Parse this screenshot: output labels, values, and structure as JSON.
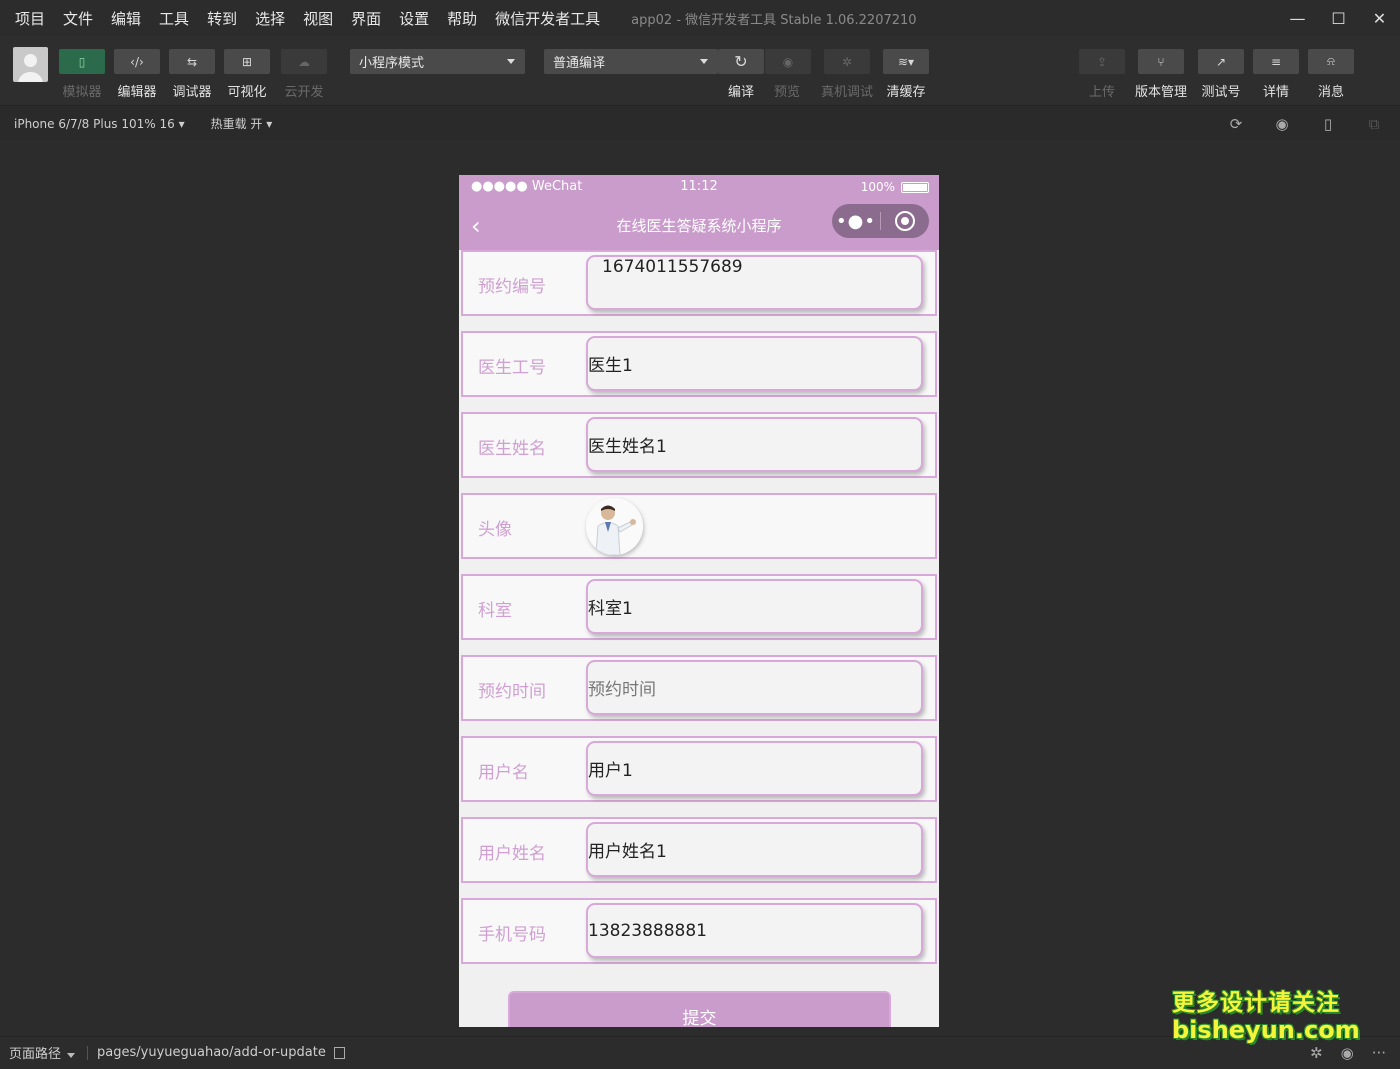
{
  "menubar": {
    "items": [
      "项目",
      "文件",
      "编辑",
      "工具",
      "转到",
      "选择",
      "视图",
      "界面",
      "设置",
      "帮助",
      "微信开发者工具"
    ],
    "window_title": "app02 - 微信开发者工具 Stable 1.06.2207210"
  },
  "toolbar": {
    "modes": [
      {
        "label": "模拟器",
        "icon": "phone-icon"
      },
      {
        "label": "编辑器",
        "icon": "code-icon"
      },
      {
        "label": "调试器",
        "icon": "debug-icon"
      },
      {
        "label": "可视化",
        "icon": "layout-icon"
      },
      {
        "label": "云开发",
        "icon": "cloud-icon"
      }
    ],
    "mode_select": "小程序模式",
    "compile_select": "普通编译",
    "actions": [
      {
        "label": "编译",
        "icon": "refresh-icon"
      },
      {
        "label": "预览",
        "icon": "eye-icon"
      },
      {
        "label": "真机调试",
        "icon": "bug-icon"
      },
      {
        "label": "清缓存",
        "icon": "layers-icon"
      }
    ],
    "right_actions": [
      {
        "label": "上传",
        "icon": "upload-icon"
      },
      {
        "label": "版本管理",
        "icon": "branch-icon"
      },
      {
        "label": "测试号",
        "icon": "external-link-icon"
      },
      {
        "label": "详情",
        "icon": "menu-icon"
      },
      {
        "label": "消息",
        "icon": "bell-icon"
      }
    ]
  },
  "subbar": {
    "device": "iPhone 6/7/8 Plus 101% 16",
    "hot_reload": "热重载 开"
  },
  "phone": {
    "status": {
      "signal": "●●●●● WeChat",
      "time": "11:12",
      "battery": "100%"
    },
    "nav_title": "在线医生答疑系统小程序",
    "fields": [
      {
        "label": "预约编号",
        "value": "1674011557689"
      },
      {
        "label": "医生工号",
        "value": "医生1"
      },
      {
        "label": "医生姓名",
        "value": "医生姓名1"
      },
      {
        "label": "头像",
        "value": ""
      },
      {
        "label": "科室",
        "value": "科室1"
      },
      {
        "label": "预约时间",
        "value": "预约时间"
      },
      {
        "label": "用户名",
        "value": "用户1"
      },
      {
        "label": "用户姓名",
        "value": "用户姓名1"
      },
      {
        "label": "手机号码",
        "value": "13823888881"
      }
    ],
    "submit_label": "提交"
  },
  "footer": {
    "path_label": "页面路径",
    "path": "pages/yuyueguahao/add-or-update"
  },
  "watermark": {
    "line1": "更多设计请关注",
    "line2": "bisheyun.com"
  },
  "colors": {
    "accent": "#c99ccb",
    "border": "#d7a8d9",
    "label": "#cfa0d1"
  }
}
